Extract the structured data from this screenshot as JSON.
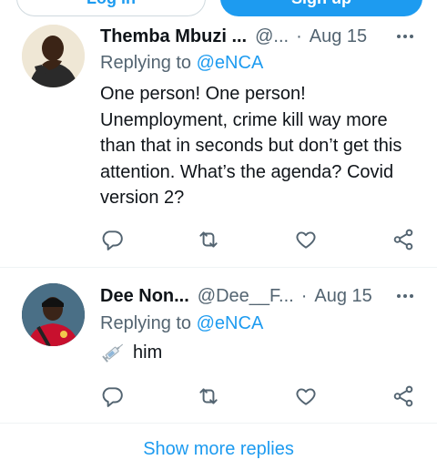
{
  "auth": {
    "login_label": "Log in",
    "signup_label": "Sign up"
  },
  "tweets": [
    {
      "display_name": "Themba Mbuzi ...",
      "handle": "@...",
      "separator": "·",
      "date": "Aug 15",
      "replying_prefix": "Replying to",
      "replying_to": "@eNCA",
      "text": "One person! One person! Unemployment, crime kill way more than that in seconds but don’t get this attention. What’s the agenda? Covid version 2?"
    },
    {
      "display_name": "Dee Non...",
      "handle": "@Dee__F...",
      "separator": "·",
      "date": "Aug 15",
      "replying_prefix": "Replying to",
      "replying_to": "@eNCA",
      "text": "him"
    }
  ],
  "footer": {
    "show_more_label": "Show more replies"
  },
  "colors": {
    "accent": "#1d9bf0",
    "secondary_text": "#536471",
    "divider": "#eff3f4"
  },
  "icons": [
    "reply-icon",
    "retweet-icon",
    "like-icon",
    "share-icon",
    "more-icon",
    "syringe-emoji"
  ]
}
